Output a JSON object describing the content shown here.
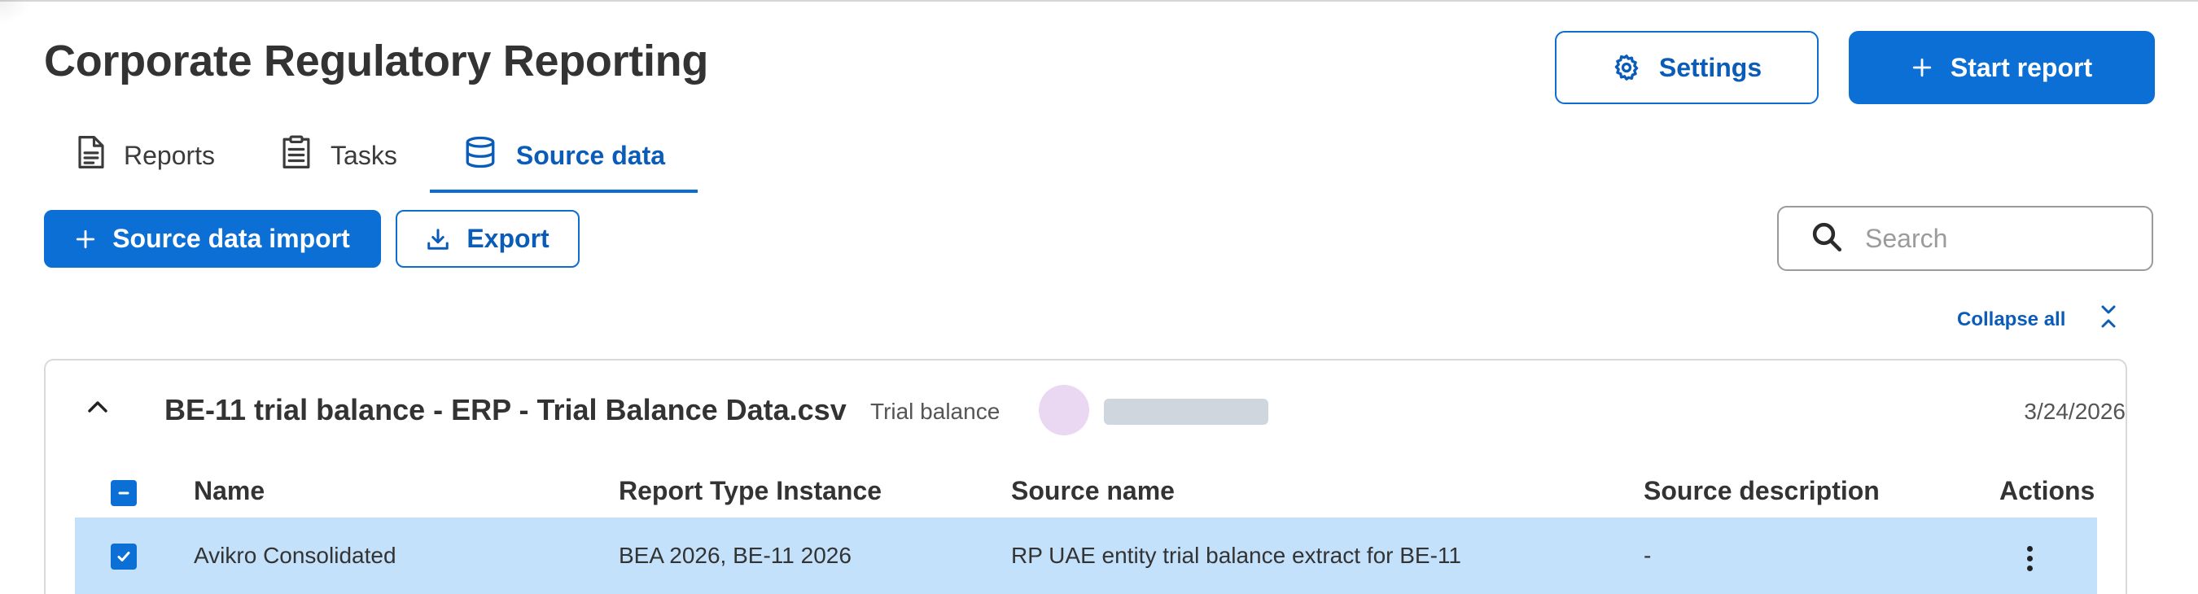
{
  "page": {
    "title": "Corporate Regulatory Reporting"
  },
  "header_actions": {
    "settings_label": "Settings",
    "start_report_label": "Start report"
  },
  "tabs": [
    {
      "label": "Reports",
      "icon": "document-icon",
      "active": false
    },
    {
      "label": "Tasks",
      "icon": "clipboard-icon",
      "active": false
    },
    {
      "label": "Source data",
      "icon": "database-icon",
      "active": true
    }
  ],
  "toolbar": {
    "import_label": "Source data import",
    "export_label": "Export"
  },
  "search": {
    "placeholder": "Search",
    "value": ""
  },
  "collapse": {
    "label": "Collapse all"
  },
  "group": {
    "title": "BE-11 trial balance - ERP - Trial Balance Data.csv",
    "type": "Trial balance",
    "date": "3/24/2026",
    "expanded": true
  },
  "table": {
    "columns": [
      "Name",
      "Report Type Instance",
      "Source name",
      "Source description",
      "Actions"
    ],
    "rows": [
      {
        "name": "Avikro Consolidated",
        "report_type_instance": "BEA 2026, BE-11 2026",
        "source_name": "RP UAE entity trial balance extract for BE-11",
        "source_description": "-",
        "selected": true
      }
    ]
  },
  "colors": {
    "accent": "#0b6fd6",
    "selected_row": "#c4e1fb",
    "avatar": "#ead7f2"
  }
}
